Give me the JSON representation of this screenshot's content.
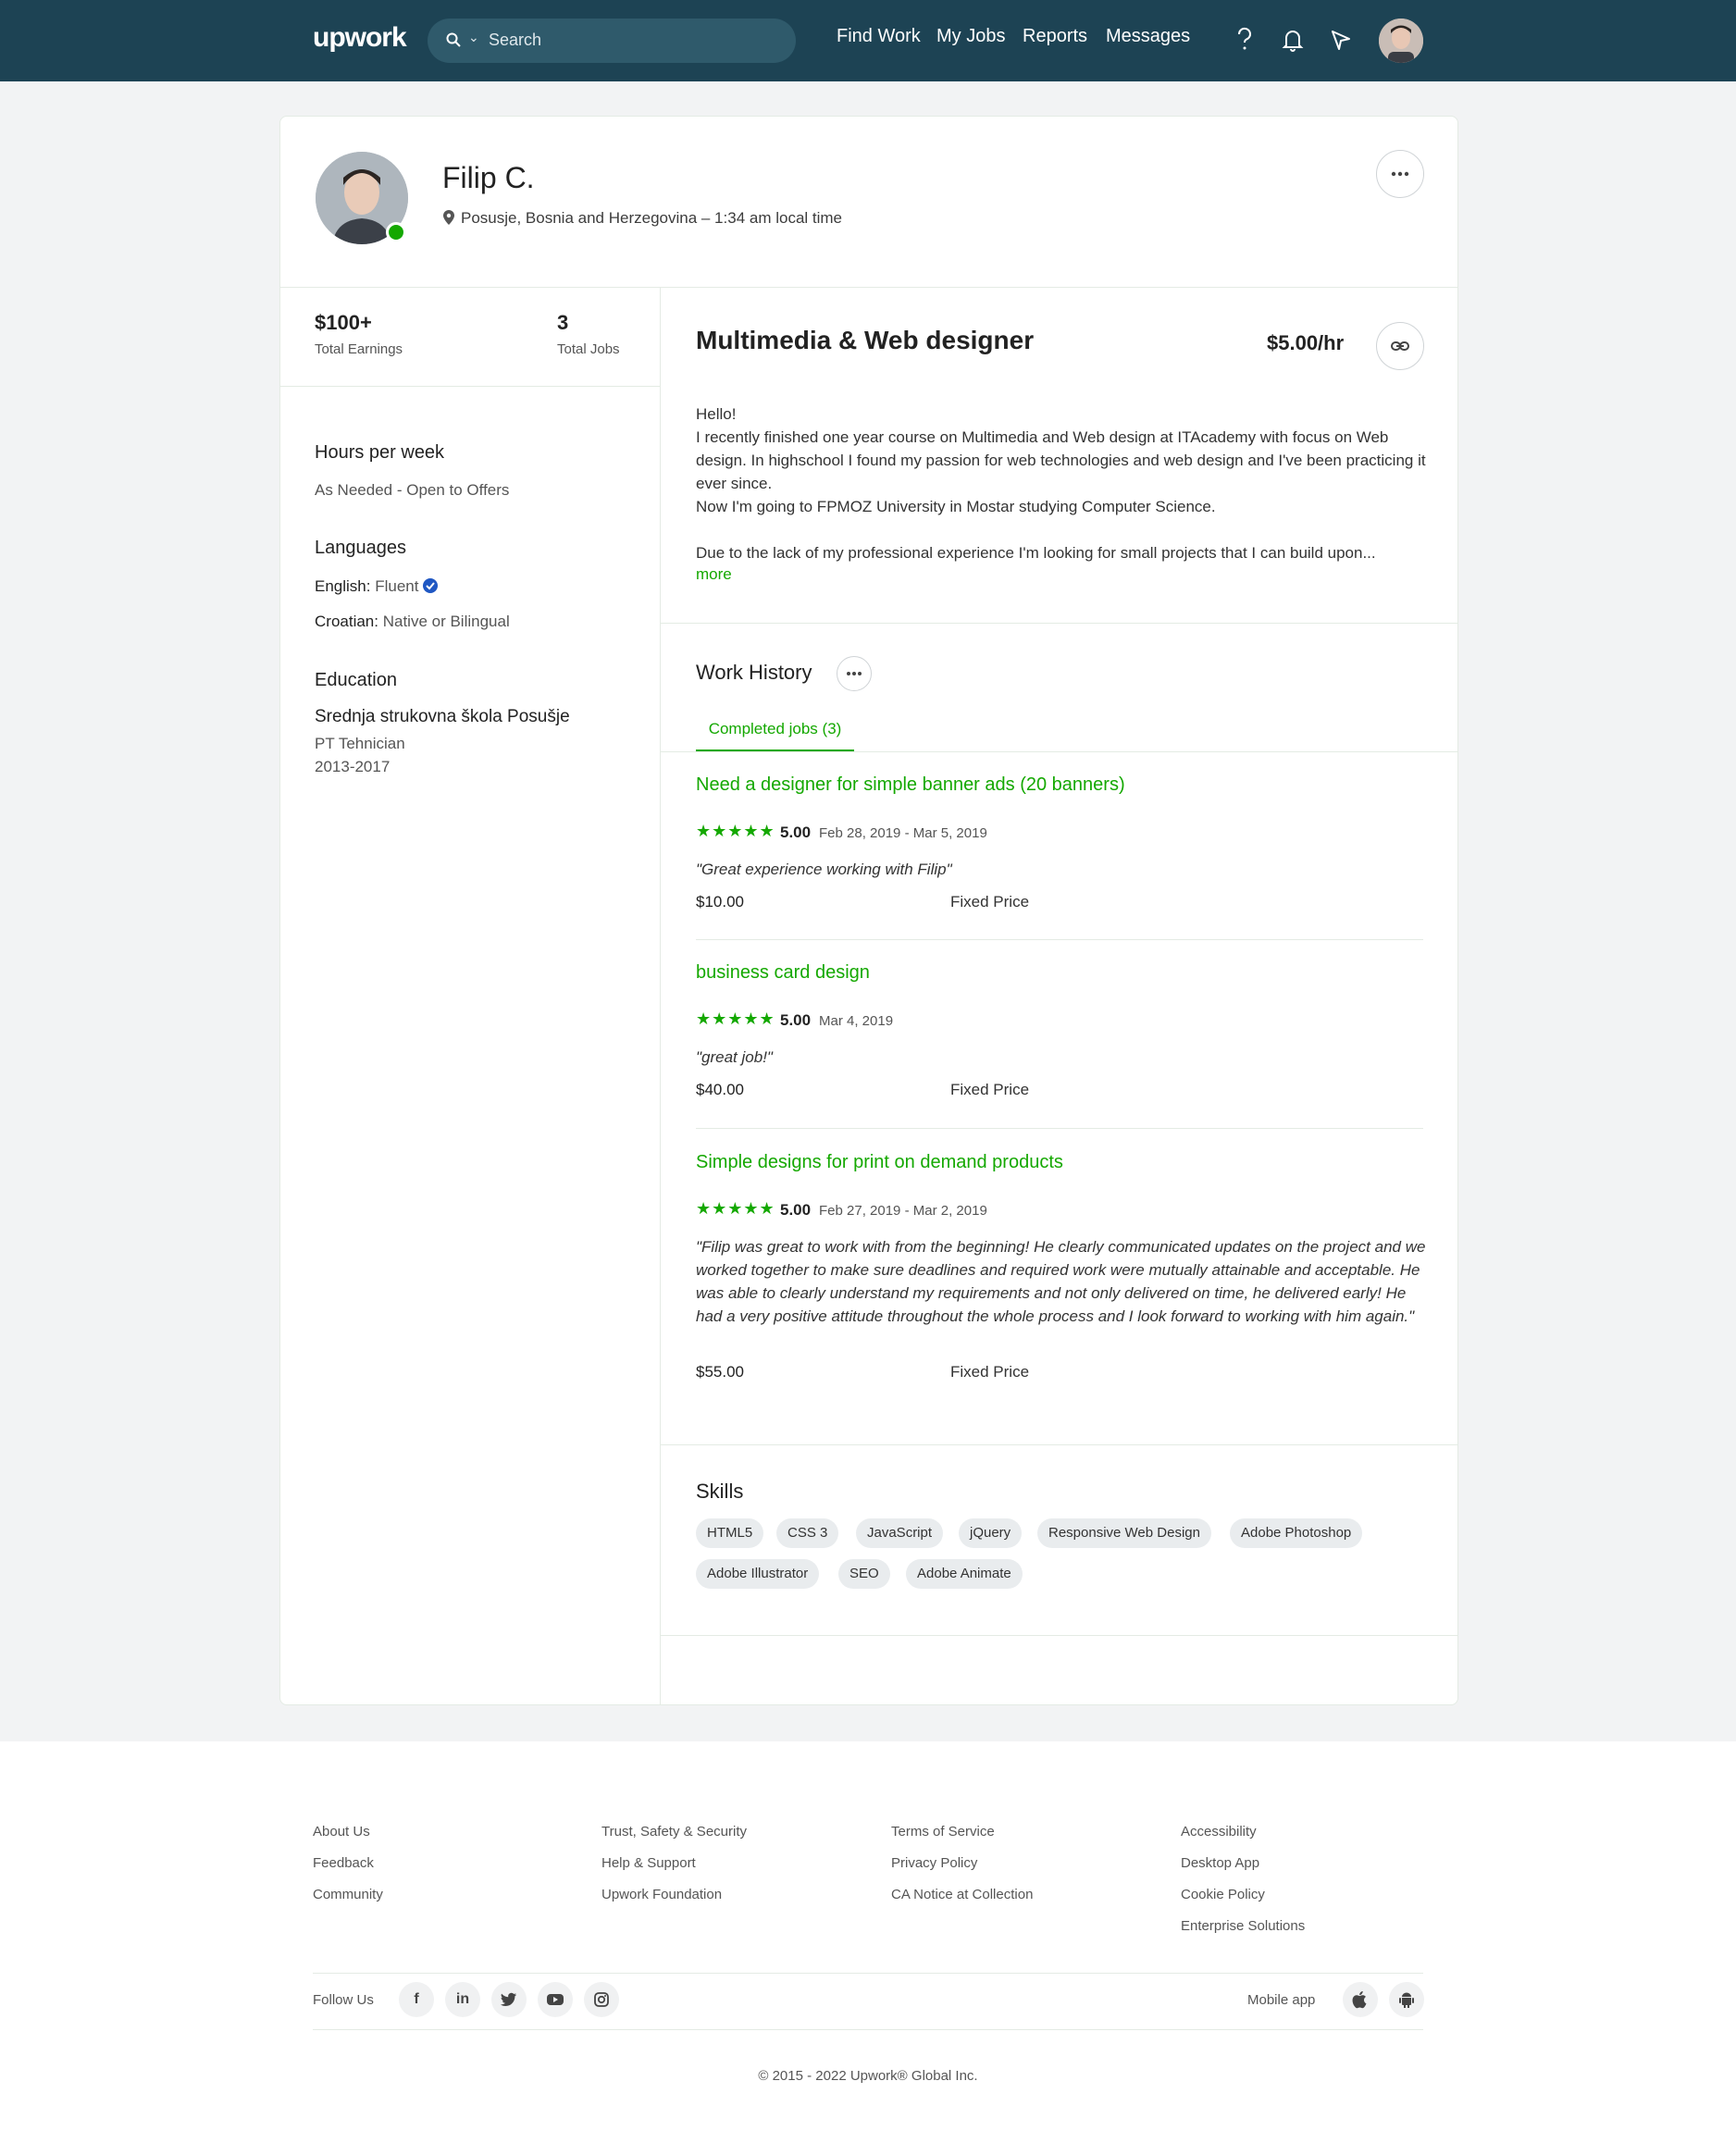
{
  "header": {
    "logo": "upwork",
    "search_placeholder": "Search",
    "nav": [
      "Find Work",
      "My Jobs",
      "Reports",
      "Messages"
    ]
  },
  "profile": {
    "name": "Filip C.",
    "location": "Posusje, Bosnia and Herzegovina – 1:34 am local time",
    "online": true
  },
  "stats": {
    "earnings_value": "$100+",
    "earnings_label": "Total Earnings",
    "jobs_value": "3",
    "jobs_label": "Total Jobs"
  },
  "sidebar": {
    "hours_heading": "Hours per week",
    "hours_value": "As Needed - Open to Offers",
    "languages_heading": "Languages",
    "languages": [
      {
        "name": "English:",
        "level": "Fluent",
        "verified": true
      },
      {
        "name": "Croatian:",
        "level": "Native or Bilingual",
        "verified": false
      }
    ],
    "education_heading": "Education",
    "education": {
      "school": "Srednja strukovna škola Posušje",
      "degree": "PT Tehnician",
      "years": "2013-2017"
    }
  },
  "main": {
    "title": "Multimedia & Web designer",
    "rate": "$5.00/hr",
    "bio": [
      "Hello!",
      "I recently finished one year course on Multimedia and Web design at ITAcademy with focus on Web design. In highschool I found my passion for web technologies and web design and I've been practicing it ever since.",
      "Now I'm going to FPMOZ University in Mostar studying Computer Science.",
      "",
      "Due to the lack of my professional experience I'm looking for small projects that I can build upon..."
    ],
    "more_label": "more"
  },
  "work_history": {
    "title": "Work History",
    "tab_label": "Completed jobs (3)",
    "jobs": [
      {
        "title": "Need a designer for simple banner ads (20 banners)",
        "rating": 5,
        "score": "5.00",
        "dates": "Feb 28, 2019 - Mar 5, 2019",
        "review": "\"Great experience working with Filip\"",
        "price": "$10.00",
        "type": "Fixed Price"
      },
      {
        "title": "business card design",
        "rating": 5,
        "score": "5.00",
        "dates": "Mar 4, 2019",
        "review": "\"great job!\"",
        "price": "$40.00",
        "type": "Fixed Price"
      },
      {
        "title": "Simple designs for print on demand products",
        "rating": 5,
        "score": "5.00",
        "dates": "Feb 27, 2019 - Mar 2, 2019",
        "review": "\"Filip was great to work with from the beginning! He clearly communicated updates on the project and we worked together to make sure deadlines and required work were mutually attainable and acceptable. He was able to clearly understand my requirements and not only delivered on time, he delivered early! He had a very positive attitude throughout the whole process and I look forward to working with him again.\"",
        "price": "$55.00",
        "type": "Fixed Price"
      }
    ]
  },
  "skills": {
    "title": "Skills",
    "items": [
      "HTML5",
      "CSS 3",
      "JavaScript",
      "jQuery",
      "Responsive Web Design",
      "Adobe Photoshop",
      "Adobe Illustrator",
      "SEO",
      "Adobe Animate"
    ]
  },
  "footer": {
    "col1": [
      "About Us",
      "Feedback",
      "Community"
    ],
    "col2": [
      "Trust, Safety & Security",
      "Help & Support",
      "Upwork Foundation"
    ],
    "col3": [
      "Terms of Service",
      "Privacy Policy",
      "CA Notice at Collection"
    ],
    "col4": [
      "Accessibility",
      "Desktop App",
      "Cookie Policy",
      "Enterprise Solutions"
    ],
    "follow_label": "Follow Us",
    "social": [
      "facebook-icon",
      "linkedin-icon",
      "twitter-icon",
      "youtube-icon",
      "instagram-icon"
    ],
    "mobile_label": "Mobile app",
    "copyright": "© 2015 - 2022 Upwork® Global Inc."
  },
  "colors": {
    "header_bg": "#1d4354",
    "accent": "#14a800"
  }
}
